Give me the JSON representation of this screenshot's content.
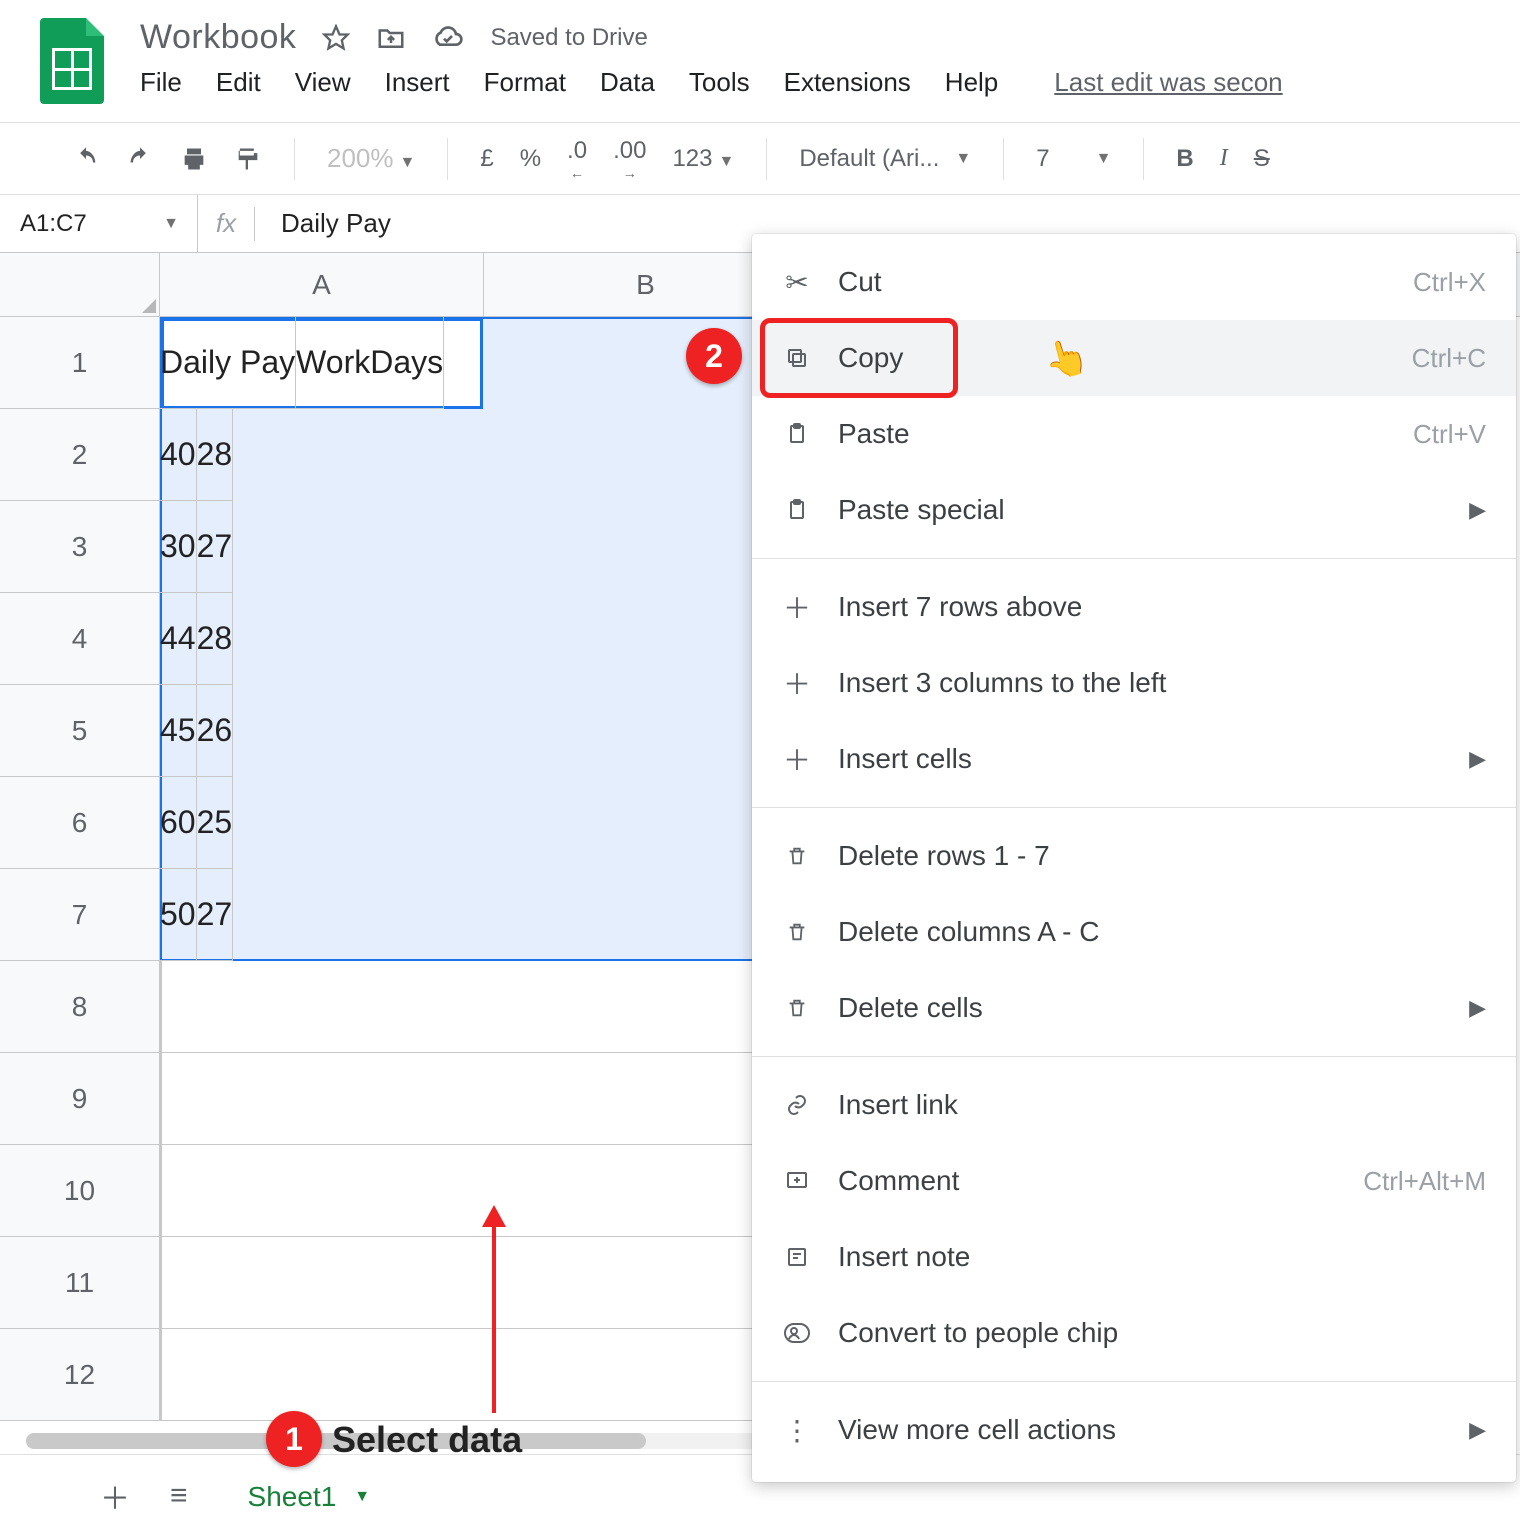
{
  "doc": {
    "title": "Workbook",
    "saved": "Saved to Drive",
    "last_edit": "Last edit was secon"
  },
  "menus": {
    "file": "File",
    "edit": "Edit",
    "view": "View",
    "insert": "Insert",
    "format": "Format",
    "data": "Data",
    "tools": "Tools",
    "extensions": "Extensions",
    "help": "Help"
  },
  "toolbar": {
    "zoom": "200%",
    "currency": "£",
    "percent": "%",
    "dec_dec": ".0",
    "inc_dec": ".00",
    "fmt": "123",
    "font": "Default (Ari...",
    "size": "7",
    "bold": "B",
    "italic": "I",
    "strike": "S"
  },
  "fbar": {
    "range": "A1:C7",
    "formula": "Daily Pay"
  },
  "columns": [
    "A",
    "B"
  ],
  "rows": [
    "1",
    "2",
    "3",
    "4",
    "5",
    "6",
    "7",
    "8",
    "9",
    "10",
    "11",
    "12"
  ],
  "cells": {
    "A": [
      "Daily Pay",
      "40",
      "30",
      "44",
      "45",
      "60",
      "50",
      "",
      "",
      "",
      "",
      ""
    ],
    "B": [
      "WorkDays",
      "28",
      "27",
      "28",
      "26",
      "25",
      "27",
      "",
      "",
      "",
      "",
      ""
    ]
  },
  "ctx": {
    "cut": {
      "label": "Cut",
      "sc": "Ctrl+X"
    },
    "copy": {
      "label": "Copy",
      "sc": "Ctrl+C"
    },
    "paste": {
      "label": "Paste",
      "sc": "Ctrl+V"
    },
    "paste_special": "Paste special",
    "insert_rows": "Insert 7 rows above",
    "insert_cols": "Insert 3 columns to the left",
    "insert_cells": "Insert cells",
    "delete_rows": "Delete rows 1 - 7",
    "delete_cols": "Delete columns A - C",
    "delete_cells": "Delete cells",
    "insert_link": "Insert link",
    "comment": {
      "label": "Comment",
      "sc": "Ctrl+Alt+M"
    },
    "insert_note": "Insert note",
    "people_chip": "Convert to people chip",
    "more": "View more cell actions"
  },
  "anno": {
    "step1_label": "Select data",
    "step1_num": "1",
    "step2_num": "2"
  },
  "tabs": {
    "sheet1": "Sheet1"
  }
}
